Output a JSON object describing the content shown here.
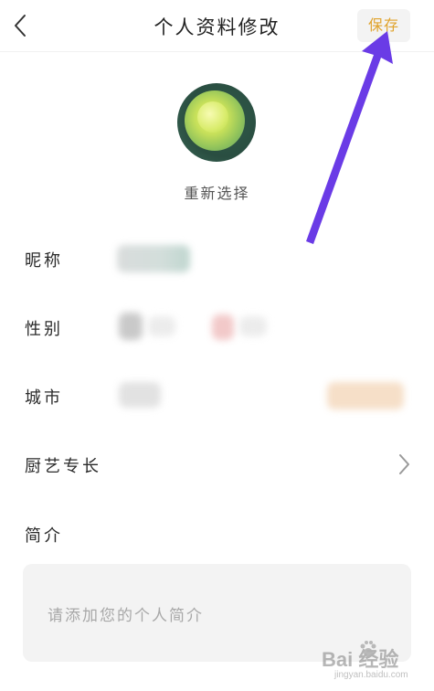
{
  "header": {
    "title": "个人资料修改",
    "save_label": "保存",
    "accent_color": "#e0a32c",
    "back_icon": "chevron-left-icon"
  },
  "avatar": {
    "reselect_label": "重新选择"
  },
  "profile": {
    "nickname_label": "昵称",
    "gender_label": "性别",
    "city_label": "城市",
    "cooking_label": "厨艺专长",
    "cooking_icon": "chevron-right-icon",
    "intro_label": "简介",
    "intro_placeholder": "请添加您的个人简介"
  },
  "watermark": {
    "main": "Bai 经验",
    "sub": "jingyan.baidu.com"
  }
}
